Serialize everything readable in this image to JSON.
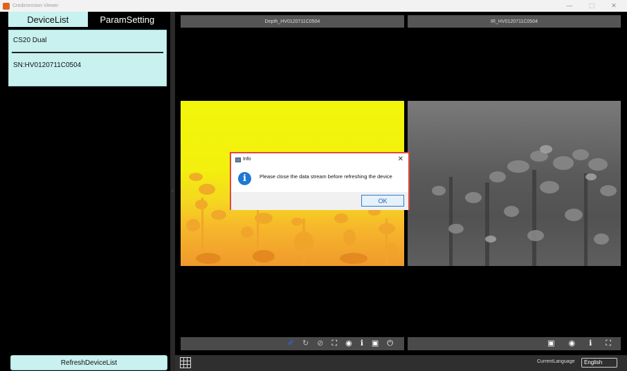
{
  "window": {
    "title": "Credimension Viewer",
    "minimize": "—",
    "maximize": "⬚",
    "close": "✕"
  },
  "left_panel": {
    "tabs": [
      {
        "label": "DeviceList",
        "active": true
      },
      {
        "label": "ParamSetting",
        "active": false
      }
    ],
    "device": {
      "name": "CS20 Dual",
      "serial": "SN:HV0120711C0504"
    },
    "refresh_button": "RefreshDeviceList"
  },
  "views": {
    "depth": {
      "title": "Depth_HV0120711C0504"
    },
    "ir": {
      "title": "IR_HV0120711C0504"
    }
  },
  "toolbars": {
    "depth_icons": [
      "pointer-icon",
      "sync-icon",
      "hide-icon",
      "fullscreen-icon",
      "record-icon",
      "info-icon",
      "save-icon",
      "power-icon"
    ],
    "ir_icons": [
      "save-icon",
      "record-icon",
      "info-icon",
      "fullscreen-icon"
    ]
  },
  "status_bar": {
    "language_label": "CurrentLanguage",
    "language_value": "English"
  },
  "dialog": {
    "title": "Info",
    "message": "Please close the data stream before refreshing the device",
    "ok_label": "OK",
    "close_label": "✕",
    "info_glyph": "i"
  },
  "colors": {
    "accent_tab": "#c8f1f0",
    "dialog_border": "#e2473f",
    "depth_yellow": "#f2f70a",
    "ok_blue": "#2a7ad4"
  }
}
